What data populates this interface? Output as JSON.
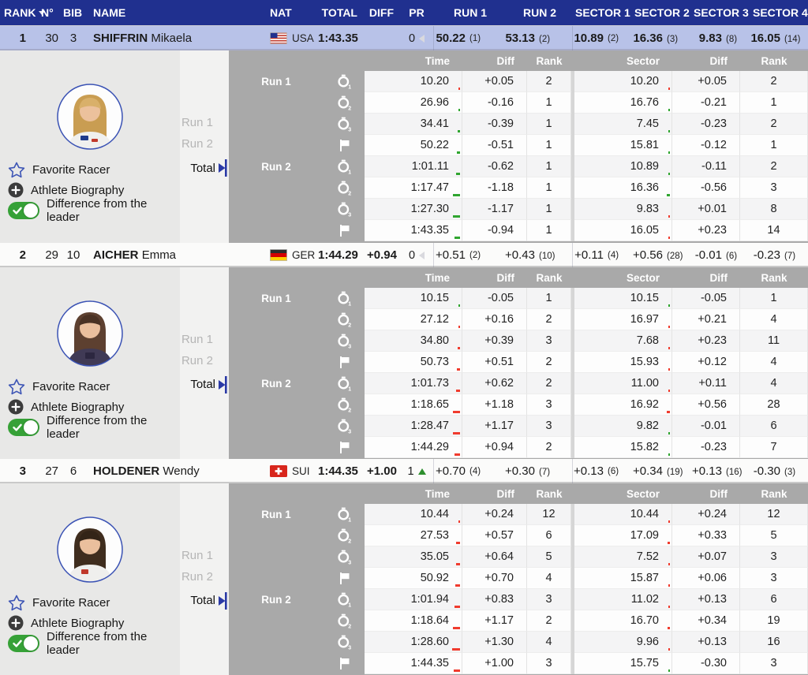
{
  "header": {
    "rank": "RANK",
    "n": "N°",
    "bib": "BIB",
    "name": "NAME",
    "nat": "NAT",
    "total": "TOTAL",
    "diff": "DIFF",
    "pr": "PR",
    "run1": "RUN 1",
    "run2": "RUN 2",
    "sector1": "SECTOR 1",
    "sector2": "SECTOR 2",
    "sector3": "SECTOR 3",
    "sector4": "SECTOR 4"
  },
  "detail_header": {
    "time": "Time",
    "diff": "Diff",
    "rank": "Rank",
    "sector": "Sector",
    "sdiff": "Diff",
    "srank": "Rank"
  },
  "left_panel": {
    "favorite": "Favorite Racer",
    "biography": "Athlete Biography",
    "difference": "Difference from the leader"
  },
  "selector": {
    "run1": "Run 1",
    "run2": "Run 2",
    "total": "Total"
  },
  "colors": {
    "accent_blue": "#20308f",
    "row_highlight": "#b8c2e8",
    "positive_red": "#d33227",
    "negative_green": "#27872a",
    "panel_gray": "#a9a9a9",
    "toggle_green": "#36a137"
  },
  "racers": [
    {
      "rank": "1",
      "n": "30",
      "bib": "3",
      "last": "SHIFFRIN",
      "first": "Mikaela",
      "nat": "USA",
      "total": "1:43.35",
      "diff": "",
      "pr": "0",
      "pr_dir": "left",
      "run1": "50.22",
      "run1_rank": "(1)",
      "run2": "53.13",
      "run2_rank": "(2)",
      "s1": "10.89",
      "s1_rank": "(2)",
      "s2": "16.36",
      "s2_rank": "(3)",
      "s3": "9.83",
      "s3_rank": "(8)",
      "s4": "16.05",
      "s4_rank": "(14)",
      "rows": [
        {
          "run": "Run 1",
          "icon": "stopwatch",
          "sub": "1",
          "time": "10.20",
          "diff": "+0.05",
          "rank": "2",
          "sector": "10.20",
          "sdiff": "+0.05",
          "srank": "2"
        },
        {
          "run": "",
          "icon": "stopwatch",
          "sub": "2",
          "time": "26.96",
          "diff": "-0.16",
          "rank": "1",
          "sector": "16.76",
          "sdiff": "-0.21",
          "srank": "1"
        },
        {
          "run": "",
          "icon": "stopwatch",
          "sub": "3",
          "time": "34.41",
          "diff": "-0.39",
          "rank": "1",
          "sector": "7.45",
          "sdiff": "-0.23",
          "srank": "2"
        },
        {
          "run": "",
          "icon": "flag",
          "sub": "",
          "time": "50.22",
          "diff": "-0.51",
          "rank": "1",
          "sector": "15.81",
          "sdiff": "-0.12",
          "srank": "1"
        },
        {
          "run": "Run 2",
          "icon": "stopwatch",
          "sub": "1",
          "time": "1:01.11",
          "diff": "-0.62",
          "rank": "1",
          "sector": "10.89",
          "sdiff": "-0.11",
          "srank": "2"
        },
        {
          "run": "",
          "icon": "stopwatch",
          "sub": "2",
          "time": "1:17.47",
          "diff": "-1.18",
          "rank": "1",
          "sector": "16.36",
          "sdiff": "-0.56",
          "srank": "3"
        },
        {
          "run": "",
          "icon": "stopwatch",
          "sub": "3",
          "time": "1:27.30",
          "diff": "-1.17",
          "rank": "1",
          "sector": "9.83",
          "sdiff": "+0.01",
          "srank": "8"
        },
        {
          "run": "",
          "icon": "flag",
          "sub": "",
          "time": "1:43.35",
          "diff": "-0.94",
          "rank": "1",
          "sector": "16.05",
          "sdiff": "+0.23",
          "srank": "14"
        }
      ]
    },
    {
      "rank": "2",
      "n": "29",
      "bib": "10",
      "last": "AICHER",
      "first": "Emma",
      "nat": "GER",
      "total": "1:44.29",
      "diff": "+0.94",
      "pr": "0",
      "pr_dir": "left",
      "run1": "+0.51",
      "run1_rank": "(2)",
      "run2": "+0.43",
      "run2_rank": "(10)",
      "s1": "+0.11",
      "s1_rank": "(4)",
      "s2": "+0.56",
      "s2_rank": "(28)",
      "s3": "-0.01",
      "s3_rank": "(6)",
      "s4": "-0.23",
      "s4_rank": "(7)",
      "rows": [
        {
          "run": "Run 1",
          "icon": "stopwatch",
          "sub": "1",
          "time": "10.15",
          "diff": "-0.05",
          "rank": "1",
          "sector": "10.15",
          "sdiff": "-0.05",
          "srank": "1"
        },
        {
          "run": "",
          "icon": "stopwatch",
          "sub": "2",
          "time": "27.12",
          "diff": "+0.16",
          "rank": "2",
          "sector": "16.97",
          "sdiff": "+0.21",
          "srank": "4"
        },
        {
          "run": "",
          "icon": "stopwatch",
          "sub": "3",
          "time": "34.80",
          "diff": "+0.39",
          "rank": "3",
          "sector": "7.68",
          "sdiff": "+0.23",
          "srank": "11"
        },
        {
          "run": "",
          "icon": "flag",
          "sub": "",
          "time": "50.73",
          "diff": "+0.51",
          "rank": "2",
          "sector": "15.93",
          "sdiff": "+0.12",
          "srank": "4"
        },
        {
          "run": "Run 2",
          "icon": "stopwatch",
          "sub": "1",
          "time": "1:01.73",
          "diff": "+0.62",
          "rank": "2",
          "sector": "11.00",
          "sdiff": "+0.11",
          "srank": "4"
        },
        {
          "run": "",
          "icon": "stopwatch",
          "sub": "2",
          "time": "1:18.65",
          "diff": "+1.18",
          "rank": "3",
          "sector": "16.92",
          "sdiff": "+0.56",
          "srank": "28"
        },
        {
          "run": "",
          "icon": "stopwatch",
          "sub": "3",
          "time": "1:28.47",
          "diff": "+1.17",
          "rank": "3",
          "sector": "9.82",
          "sdiff": "-0.01",
          "srank": "6"
        },
        {
          "run": "",
          "icon": "flag",
          "sub": "",
          "time": "1:44.29",
          "diff": "+0.94",
          "rank": "2",
          "sector": "15.82",
          "sdiff": "-0.23",
          "srank": "7"
        }
      ]
    },
    {
      "rank": "3",
      "n": "27",
      "bib": "6",
      "last": "HOLDENER",
      "first": "Wendy",
      "nat": "SUI",
      "total": "1:44.35",
      "diff": "+1.00",
      "pr": "1",
      "pr_dir": "up",
      "run1": "+0.70",
      "run1_rank": "(4)",
      "run2": "+0.30",
      "run2_rank": "(7)",
      "s1": "+0.13",
      "s1_rank": "(6)",
      "s2": "+0.34",
      "s2_rank": "(19)",
      "s3": "+0.13",
      "s3_rank": "(16)",
      "s4": "-0.30",
      "s4_rank": "(3)",
      "rows": [
        {
          "run": "Run 1",
          "icon": "stopwatch",
          "sub": "1",
          "time": "10.44",
          "diff": "+0.24",
          "rank": "12",
          "sector": "10.44",
          "sdiff": "+0.24",
          "srank": "12"
        },
        {
          "run": "",
          "icon": "stopwatch",
          "sub": "2",
          "time": "27.53",
          "diff": "+0.57",
          "rank": "6",
          "sector": "17.09",
          "sdiff": "+0.33",
          "srank": "5"
        },
        {
          "run": "",
          "icon": "stopwatch",
          "sub": "3",
          "time": "35.05",
          "diff": "+0.64",
          "rank": "5",
          "sector": "7.52",
          "sdiff": "+0.07",
          "srank": "3"
        },
        {
          "run": "",
          "icon": "flag",
          "sub": "",
          "time": "50.92",
          "diff": "+0.70",
          "rank": "4",
          "sector": "15.87",
          "sdiff": "+0.06",
          "srank": "3"
        },
        {
          "run": "Run 2",
          "icon": "stopwatch",
          "sub": "1",
          "time": "1:01.94",
          "diff": "+0.83",
          "rank": "3",
          "sector": "11.02",
          "sdiff": "+0.13",
          "srank": "6"
        },
        {
          "run": "",
          "icon": "stopwatch",
          "sub": "2",
          "time": "1:18.64",
          "diff": "+1.17",
          "rank": "2",
          "sector": "16.70",
          "sdiff": "+0.34",
          "srank": "19"
        },
        {
          "run": "",
          "icon": "stopwatch",
          "sub": "3",
          "time": "1:28.60",
          "diff": "+1.30",
          "rank": "4",
          "sector": "9.96",
          "sdiff": "+0.13",
          "srank": "16"
        },
        {
          "run": "",
          "icon": "flag",
          "sub": "",
          "time": "1:44.35",
          "diff": "+1.00",
          "rank": "3",
          "sector": "15.75",
          "sdiff": "-0.30",
          "srank": "3"
        }
      ]
    }
  ]
}
